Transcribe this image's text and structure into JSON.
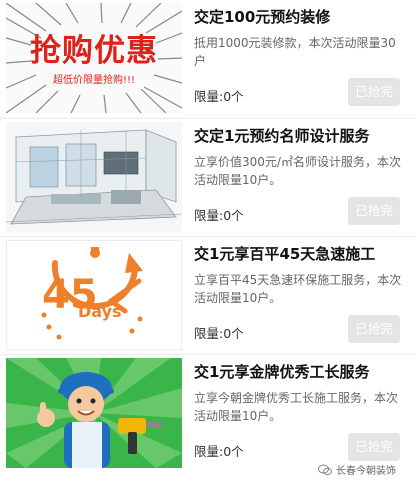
{
  "items": [
    {
      "title": "交定100元预约装修",
      "desc": "抵用1000元装修款，本次活动限量30户",
      "limit": "限量:0个",
      "button": "已抢完",
      "thumb_text": "抢购优惠",
      "thumb_sub": "超低价限量抢购!!!"
    },
    {
      "title": "交定1元预约名师设计服务",
      "desc": "立享价值300元/㎡名师设计服务，本次活动限量10户。",
      "limit": "限量:0个",
      "button": "已抢完"
    },
    {
      "title": "交1元享百平45天急速施工",
      "desc": "立享百平45天急速环保施工服务，本次活动限量10户。",
      "limit": "限量:0个",
      "button": "已抢完",
      "thumb_num": "45",
      "thumb_word": "Days"
    },
    {
      "title": "交1元享金牌优秀工长服务",
      "desc": "立享今朝金牌优秀工长施工服务，本次活动限量10户。",
      "limit": "限量:0个",
      "button": "已抢完"
    }
  ],
  "watermark": "长春今朝装饰",
  "colors": {
    "accent": "#e0211a",
    "orange": "#f07f2a",
    "button_disabled": "#e4e4e4",
    "green": "#3ab54a"
  }
}
